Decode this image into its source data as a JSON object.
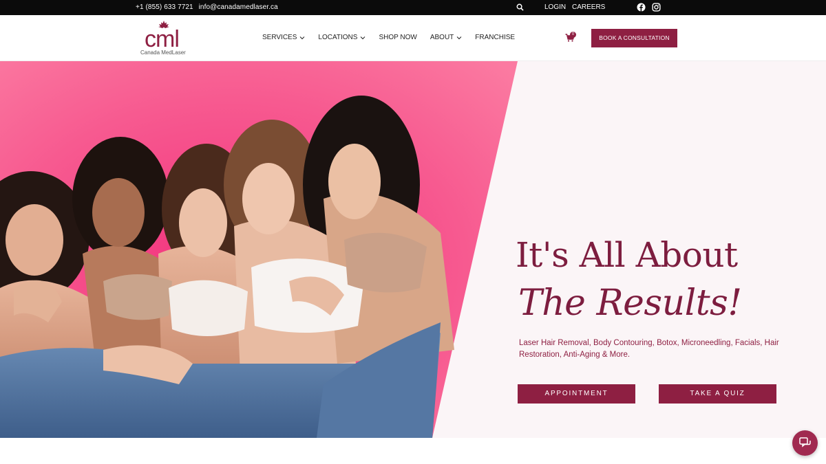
{
  "topbar": {
    "phone": "+1 (855) 633 7721",
    "email": "info@canadamedlaser.ca",
    "login_label": "LOGIN",
    "careers_label": "CAREERS",
    "icons": [
      "search-icon",
      "facebook-icon",
      "instagram-icon"
    ]
  },
  "header": {
    "logo_mark": "cml",
    "logo_name": "Canada MedLaser",
    "nav": [
      {
        "label": "SERVICES",
        "has_dropdown": true
      },
      {
        "label": "LOCATIONS",
        "has_dropdown": true
      },
      {
        "label": "SHOP NOW",
        "has_dropdown": false
      },
      {
        "label": "ABOUT",
        "has_dropdown": true
      },
      {
        "label": "FRANCHISE",
        "has_dropdown": false
      }
    ],
    "cart_count": "0",
    "book_label": "BOOK A CONSULTATION"
  },
  "hero": {
    "headline_line1": "It's All About",
    "headline_line2": "The Results!",
    "subtext": "Laser Hair Removal, Body Contouring, Botox, Microneedling, Facials, Hair Restoration, Anti-Aging & More.",
    "appointment_label": "APPOINTMENT",
    "quiz_label": "TAKE A QUIZ"
  },
  "colors": {
    "brand": "#8e1f42",
    "hero_pink": "#f25f8f",
    "hero_panel": "#fbf5f7",
    "topbar": "#0b0b0b"
  }
}
